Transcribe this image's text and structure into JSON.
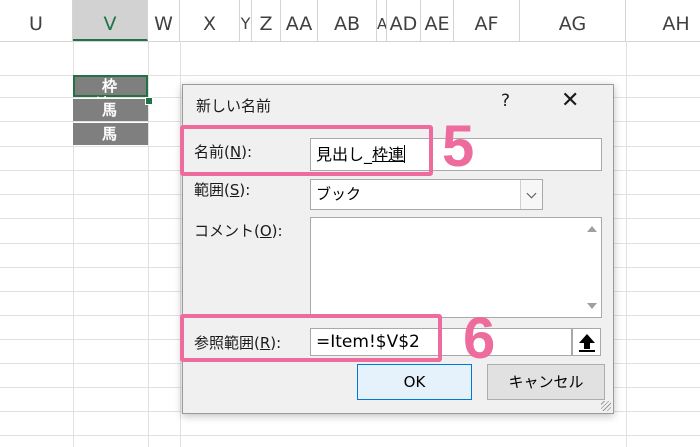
{
  "sheet": {
    "columns": [
      "U",
      "V",
      "W",
      "X",
      "Y",
      "Z",
      "AA",
      "AB",
      "AC",
      "AD",
      "AE",
      "AF",
      "AG",
      "AH"
    ],
    "selected_column": "V",
    "cells": [
      "枠 連",
      "馬 連",
      "馬 単"
    ],
    "accent": "#217346",
    "cell_fill": "#7f7f7f"
  },
  "dialog": {
    "title": "新しい名前",
    "help_glyph": "?",
    "close_glyph": "✕",
    "name_label_prefix": "名前(",
    "name_label_key": "N",
    "name_label_suffix": "):",
    "name_value_prefix": "見出し_",
    "name_value_underlined": "枠連",
    "scope_label_prefix": "範囲(",
    "scope_label_key": "S",
    "scope_label_suffix": "):",
    "scope_value": "ブック",
    "comment_label_prefix": "コメント(",
    "comment_label_key": "O",
    "comment_label_suffix": "):",
    "comment_value": "",
    "refers_label_prefix": "参照範囲(",
    "refers_label_key": "R",
    "refers_label_suffix": "):",
    "refers_value": "=Item!$V$2",
    "ok_label": "OK",
    "cancel_label": "キャンセル"
  },
  "annotations": {
    "step_name": "5",
    "step_refers": "6",
    "highlight_color": "#ee6b9e"
  }
}
